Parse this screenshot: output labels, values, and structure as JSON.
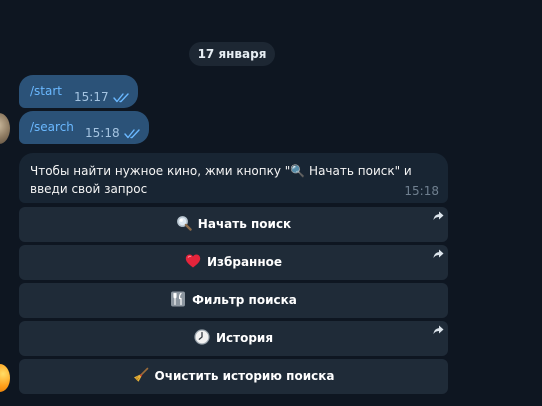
{
  "chat": {
    "date_separator": "17 января",
    "outgoing": [
      {
        "text": "/start",
        "time": "15:17",
        "status_icon": "double-check-icon"
      },
      {
        "text": "/search",
        "time": "15:18",
        "status_icon": "double-check-icon"
      }
    ],
    "incoming": {
      "text": "Чтобы найти нужное кино, жми кнопку \"🔍 Начать поиск\" и введи свой запрос",
      "time": "15:18"
    },
    "keyboard": [
      {
        "icon": "magnifier-icon",
        "label": "Начать поиск",
        "has_share_arrow": true
      },
      {
        "icon": "heart-icon",
        "label": "Избранное",
        "has_share_arrow": true
      },
      {
        "icon": "fork-knife-icon",
        "label": "Фильтр поиска",
        "has_share_arrow": false
      },
      {
        "icon": "clock-icon",
        "label": "История",
        "has_share_arrow": true
      },
      {
        "icon": "broom-icon",
        "label": "Очистить историю поиска",
        "has_share_arrow": false
      }
    ]
  },
  "colors": {
    "background": "#0e1621",
    "outgoing_bubble": "#2b5278",
    "incoming_bubble": "#182533",
    "keyboard_button": "#1f2b38",
    "command_link": "#6ab8ff"
  }
}
